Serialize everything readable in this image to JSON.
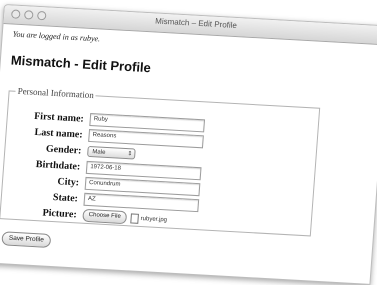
{
  "window": {
    "title": "Mismatch – Edit Profile"
  },
  "status": {
    "logged_in": "You are logged in as rubye."
  },
  "page": {
    "heading": "Mismatch - Edit Profile"
  },
  "form": {
    "legend": "Personal Information",
    "fields": {
      "first_name": {
        "label": "First name:",
        "value": "Ruby"
      },
      "last_name": {
        "label": "Last name:",
        "value": "Reasons"
      },
      "gender": {
        "label": "Gender:",
        "value": "Male"
      },
      "birthdate": {
        "label": "Birthdate:",
        "value": "1972-06-18"
      },
      "city": {
        "label": "City:",
        "value": "Conundrum"
      },
      "state": {
        "label": "State:",
        "value": "AZ"
      },
      "picture": {
        "label": "Picture:",
        "button": "Choose File",
        "filename": "rubyer.jpg"
      }
    },
    "save_label": "Save Profile"
  },
  "icons": {
    "select_arrows": "⇕",
    "file": "file-icon"
  }
}
